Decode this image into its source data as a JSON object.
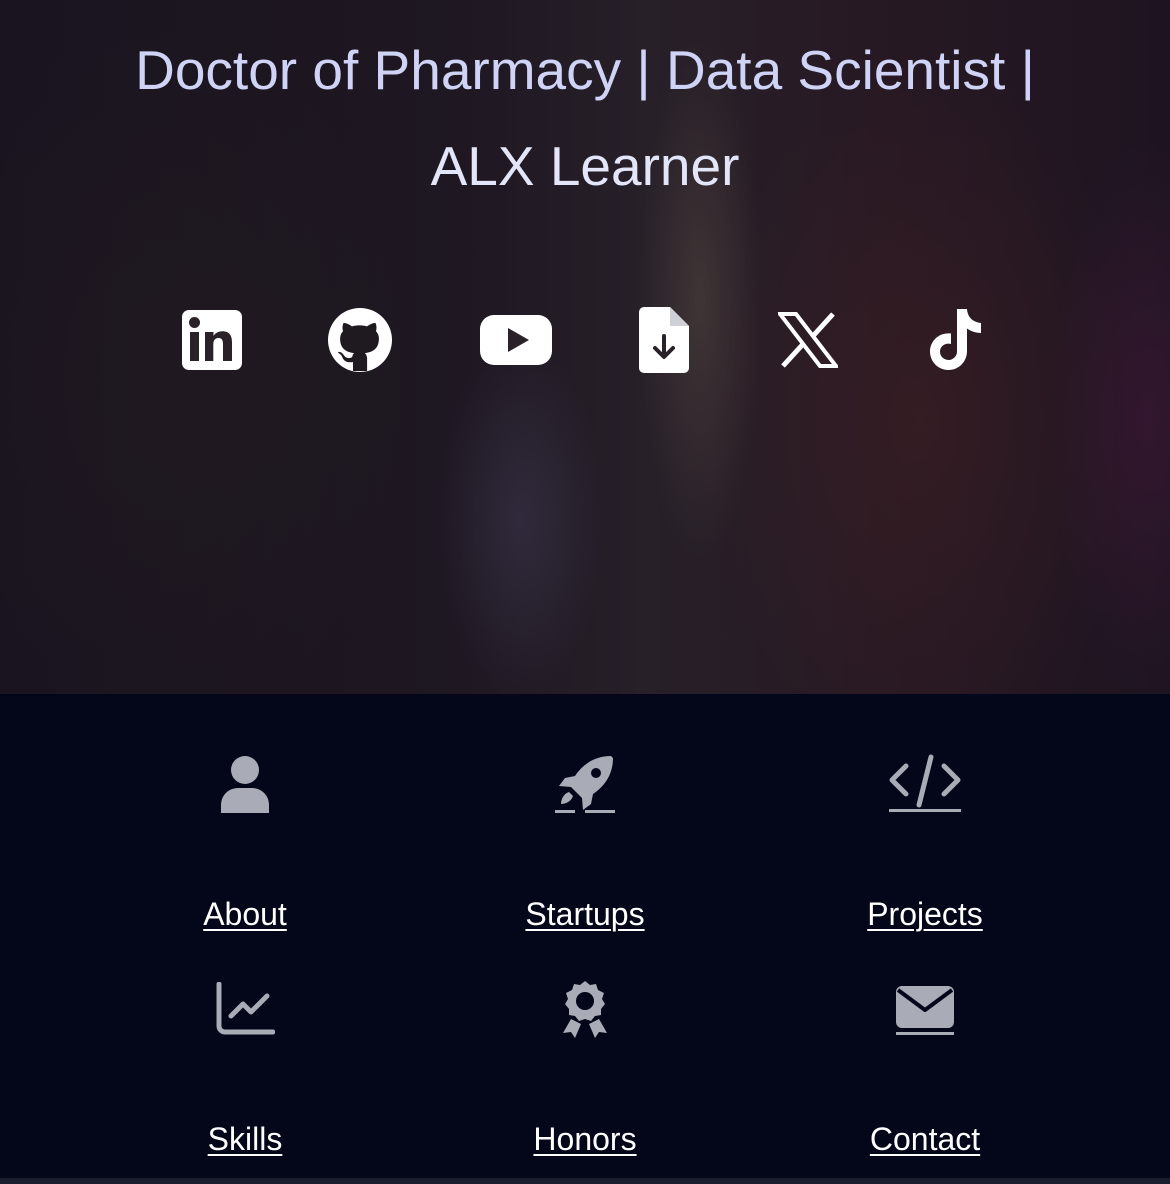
{
  "hero": {
    "headline_line1": "Doctor of Pharmacy | Data Scientist |",
    "headline_line2": "ALX Learner",
    "social_links": [
      {
        "name": "linkedin",
        "icon": "linkedin-icon"
      },
      {
        "name": "github",
        "icon": "github-icon"
      },
      {
        "name": "youtube",
        "icon": "youtube-icon"
      },
      {
        "name": "resume-download",
        "icon": "file-download-icon"
      },
      {
        "name": "x",
        "icon": "x-icon"
      },
      {
        "name": "tiktok",
        "icon": "tiktok-icon"
      }
    ]
  },
  "nav": {
    "items": [
      {
        "label": "About",
        "icon": "user-icon"
      },
      {
        "label": "Startups",
        "icon": "rocket-icon"
      },
      {
        "label": "Projects",
        "icon": "code-icon"
      },
      {
        "label": "Skills",
        "icon": "chart-line-icon"
      },
      {
        "label": "Honors",
        "icon": "award-icon"
      },
      {
        "label": "Contact",
        "icon": "envelope-icon"
      }
    ]
  },
  "colors": {
    "headline": "#cfd3f6",
    "nav_background": "#04061a",
    "nav_icon": "#a9abb6",
    "link_text": "#ffffff"
  }
}
